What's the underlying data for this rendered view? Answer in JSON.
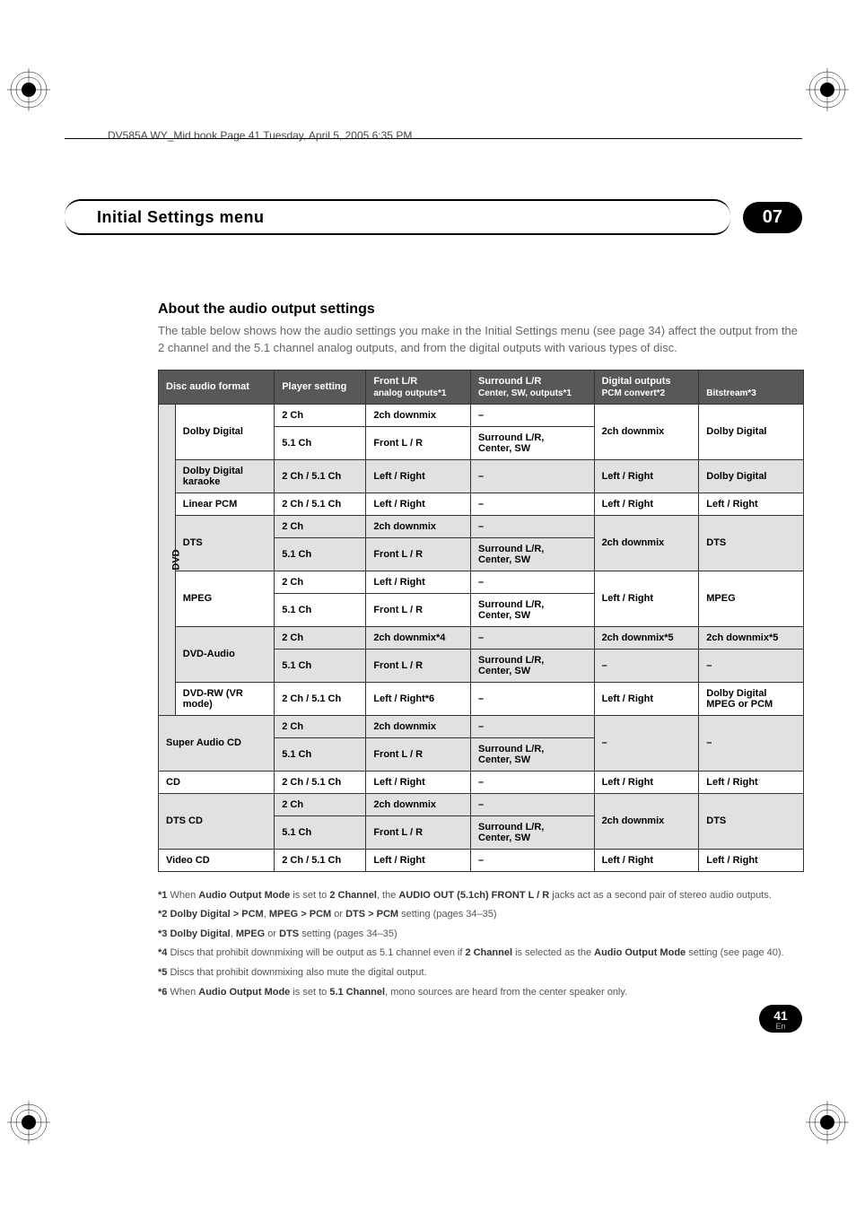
{
  "header_note": "DV585A WY_Mid.book  Page 41  Tuesday, April 5, 2005  6:35 PM",
  "section": {
    "title": "Initial Settings menu",
    "chapter": "07"
  },
  "subhead": "About the audio output settings",
  "intro": "The table below shows how the audio settings you make in the Initial Settings menu (see page 34) affect the output from the 2 channel and the 5.1 channel analog outputs, and from the digital outputs with various types of disc.",
  "thead": {
    "c0": "Disc audio format",
    "c1": "Player setting",
    "c2": {
      "t": "Front L/R",
      "s": "analog outputs*1"
    },
    "c3": {
      "t": "Surround L/R",
      "s": "Center, SW, outputs*1"
    },
    "c4": {
      "t": "Digital outputs",
      "s1": "PCM convert*2",
      "s2": "Bitstream*3"
    }
  },
  "rotlabel": "DVD",
  "rows": {
    "dd": {
      "fmt": "Dolby Digital",
      "p1": "2 Ch",
      "f1": "2ch downmix",
      "s1": "–",
      "pc": "2ch downmix",
      "bs": "Dolby Digital",
      "p2": "5.1 Ch",
      "f2": "Front L / R",
      "s2a": "Surround L/R,",
      "s2b": "Center, SW"
    },
    "ddk": {
      "fmt": "Dolby Digital karaoke",
      "p": "2 Ch / 5.1 Ch",
      "f": "Left / Right",
      "s": "–",
      "pc": "Left / Right",
      "bs": "Dolby Digital"
    },
    "lpcm": {
      "fmt": "Linear PCM",
      "p": "2 Ch / 5.1 Ch",
      "f": "Left / Right",
      "s": "–",
      "pc": "Left / Right",
      "bs": "Left / Right"
    },
    "dts": {
      "fmt": "DTS",
      "p1": "2 Ch",
      "f1": "2ch downmix",
      "s1": "–",
      "pc": "2ch downmix",
      "bs": "DTS",
      "p2": "5.1 Ch",
      "f2": "Front L / R",
      "s2a": "Surround L/R,",
      "s2b": "Center, SW"
    },
    "mpeg": {
      "fmt": "MPEG",
      "p1": "2 Ch",
      "f1": "Left / Right",
      "s1": "–",
      "pc": "Left / Right",
      "bs": "MPEG",
      "p2": "5.1 Ch",
      "f2": "Front L / R",
      "s2a": "Surround L/R,",
      "s2b": "Center, SW"
    },
    "dvda": {
      "fmt": "DVD-Audio",
      "p1": "2 Ch",
      "f1": "2ch downmix*4",
      "s1": "–",
      "pc1": "2ch downmix*5",
      "bs1": "2ch downmix*5",
      "p2": "5.1 Ch",
      "f2": "Front L / R",
      "s2a": "Surround L/R,",
      "s2b": "Center, SW",
      "pc2": "–",
      "bs2": "–"
    },
    "dvdrw": {
      "fmt": "DVD-RW (VR mode)",
      "p": "2 Ch / 5.1 Ch",
      "f": "Left / Right*6",
      "s": "–",
      "pc": "Left / Right",
      "bs1": "Dolby Digital",
      "bs2": "MPEG or PCM"
    },
    "sacd": {
      "fmt": "Super Audio CD",
      "p1": "2 Ch",
      "f1": "2ch downmix",
      "s1": "–",
      "pc": "–",
      "bs": "–",
      "p2": "5.1 Ch",
      "f2": "Front L / R",
      "s2a": "Surround L/R,",
      "s2b": "Center, SW"
    },
    "cd": {
      "fmt": "CD",
      "p": "2 Ch / 5.1 Ch",
      "f": "Left / Right",
      "s": "–",
      "pc": "Left / Right",
      "bs": "Left / Right"
    },
    "dtscd": {
      "fmt": "DTS CD",
      "p1": "2 Ch",
      "f1": "2ch downmix",
      "s1": "–",
      "pc": "2ch downmix",
      "bs": "DTS",
      "p2": "5.1 Ch",
      "f2": "Front L / R",
      "s2a": "Surround L/R,",
      "s2b": "Center, SW"
    },
    "vcd": {
      "fmt": "Video CD",
      "p": "2 Ch / 5.1 Ch",
      "f": "Left / Right",
      "s": "–",
      "pc": "Left / Right",
      "bs": "Left / Right"
    }
  },
  "footnotes": {
    "n1a": "*1 ",
    "n1b": "When ",
    "n1c": "Audio Output Mode",
    "n1d": " is set to ",
    "n1e": "2 Channel",
    "n1f": ", the ",
    "n1g": "AUDIO OUT (5.1ch) FRONT L / R",
    "n1h": " jacks act as a second pair of stereo audio outputs.",
    "n2a": "*2 ",
    "n2b": "Dolby Digital > PCM",
    "n2c": ", ",
    "n2d": "MPEG > PCM",
    "n2e": " or ",
    "n2f": "DTS > PCM",
    "n2g": " setting (pages 34–35)",
    "n3a": "*3 ",
    "n3b": "Dolby Digital",
    "n3c": ", ",
    "n3d": "MPEG",
    "n3e": " or ",
    "n3f": "DTS",
    "n3g": " setting (pages 34–35)",
    "n4a": "*4 ",
    "n4b": "Discs that prohibit downmixing will be output as 5.1 channel even if ",
    "n4c": "2 Channel",
    "n4d": " is selected as the ",
    "n4e": "Audio Output Mode",
    "n4f": " setting (see page 40).",
    "n5a": "*5 ",
    "n5b": "Discs that prohibit downmixing also mute the digital output.",
    "n6a": "*6 ",
    "n6b": "When ",
    "n6c": "Audio Output Mode",
    "n6d": " is set to ",
    "n6e": "5.1 Channel",
    "n6f": ", mono sources are heard from the center speaker only."
  },
  "pagenum": {
    "num": "41",
    "en": "En"
  }
}
